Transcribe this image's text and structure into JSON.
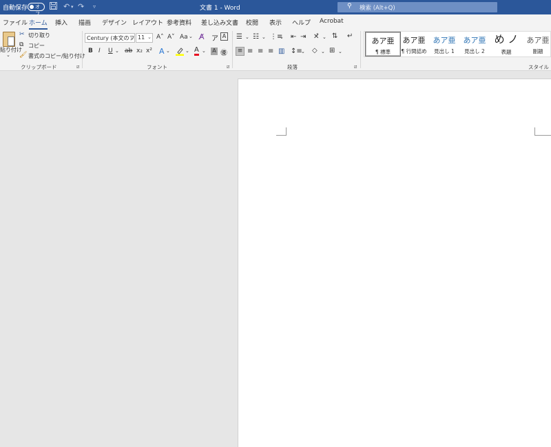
{
  "titlebar": {
    "autosave_label": "自動保存",
    "autosave_state": "オフ",
    "save_icon": "save-icon",
    "undo_icon": "undo-icon",
    "redo_icon": "redo-icon",
    "customize_icon": "customize-qat-icon",
    "document_title": "文書 1  -  Word",
    "search_placeholder": "検索 (Alt+Q)",
    "search_icon": "search-icon",
    "background_color": "#2b579a"
  },
  "tabs": [
    {
      "label": "ファイル"
    },
    {
      "label": "ホーム",
      "active": true
    },
    {
      "label": "挿入"
    },
    {
      "label": "描画"
    },
    {
      "label": "デザイン"
    },
    {
      "label": "レイアウト"
    },
    {
      "label": "参考資料"
    },
    {
      "label": "差し込み文書"
    },
    {
      "label": "校閲"
    },
    {
      "label": "表示"
    },
    {
      "label": "ヘルプ"
    },
    {
      "label": "Acrobat"
    }
  ],
  "clipboard": {
    "paste_label": "貼り付け",
    "cut_label": "切り取り",
    "copy_label": "コピー",
    "format_painter_label": "書式のコピー/貼り付け",
    "group_label": "クリップボード"
  },
  "font": {
    "font_name": "Century (本文のフ",
    "font_size": "11",
    "grow": "A˄",
    "shrink": "A˅",
    "change_case": "Aa",
    "bold": "B",
    "italic": "I",
    "underline": "U",
    "strikethrough": "ab",
    "subscript": "x₂",
    "superscript": "x²",
    "text_effects": "A",
    "font_color": "A",
    "char_shading": "A",
    "group_label": "フォント"
  },
  "paragraph": {
    "group_label": "段落"
  },
  "styles": {
    "items": [
      {
        "sample": "あア亜",
        "name": "¶ 標準",
        "selected": true
      },
      {
        "sample": "あア亜",
        "name": "¶ 行間詰め"
      },
      {
        "sample": "あア亜",
        "name": "見出し 1"
      },
      {
        "sample": "あア亜",
        "name": "見出し 2"
      },
      {
        "sample": "め ノ",
        "name": "表題"
      },
      {
        "sample": "あア亜",
        "name": "副題"
      }
    ],
    "group_label": "スタイル"
  },
  "colors": {
    "accent": "#2b579a",
    "heading_blue": "#2e74b5",
    "highlight": "#ffff00",
    "font_red": "#e81123"
  }
}
